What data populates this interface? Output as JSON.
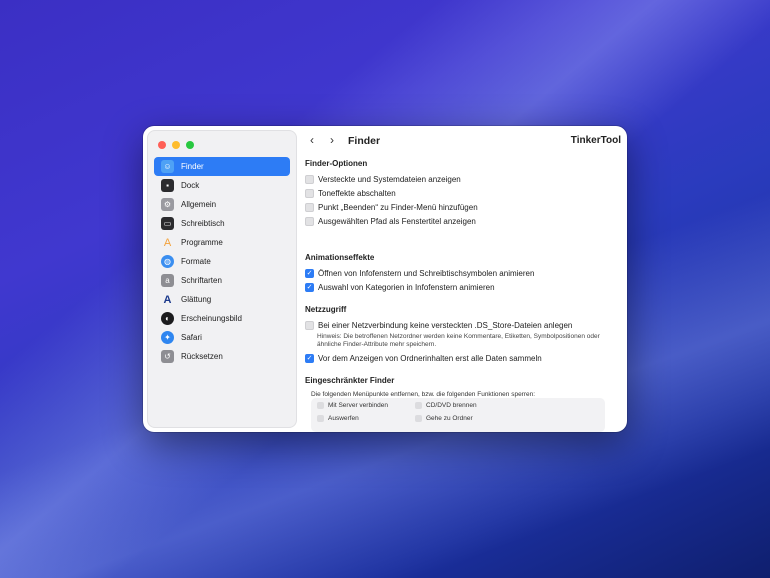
{
  "window": {
    "app_name": "TinkerTool",
    "page_title": "Finder"
  },
  "sidebar": {
    "items": [
      {
        "label": "Finder",
        "icon": "finder-icon",
        "color": "#4ea1f5",
        "active": true
      },
      {
        "label": "Dock",
        "icon": "dock-icon",
        "color": "#2b2b2e"
      },
      {
        "label": "Allgemein",
        "icon": "general-icon",
        "color": "#9a9aa0"
      },
      {
        "label": "Schreibtisch",
        "icon": "desktop-icon",
        "color": "#2b2b2e"
      },
      {
        "label": "Programme",
        "icon": "applications-icon",
        "color": "#f3a23b"
      },
      {
        "label": "Formate",
        "icon": "globe-icon",
        "color": "#3a8ef0"
      },
      {
        "label": "Schriftarten",
        "icon": "fonts-icon",
        "color": "#8e8e93"
      },
      {
        "label": "Glättung",
        "icon": "smoothing-icon",
        "color": "#1c3a8c"
      },
      {
        "label": "Erscheinungsbild",
        "icon": "appearance-icon",
        "color": "#1c1c1e"
      },
      {
        "label": "Safari",
        "icon": "safari-icon",
        "color": "#2f86f0"
      },
      {
        "label": "Rücksetzen",
        "icon": "reset-icon",
        "color": "#8e8e93"
      }
    ]
  },
  "sections": {
    "finder_options": {
      "title": "Finder-Optionen",
      "options": [
        {
          "label": "Versteckte und Systemdateien anzeigen",
          "checked": false
        },
        {
          "label": "Toneffekte abschalten",
          "checked": false
        },
        {
          "label": "Punkt „Beenden“ zu Finder-Menü hinzufügen",
          "checked": false
        },
        {
          "label": "Ausgewählten Pfad als Fenstertitel anzeigen",
          "checked": false
        }
      ]
    },
    "animation": {
      "title": "Animationseffekte",
      "options": [
        {
          "label": "Öffnen von Infofenstern und Schreibtischsymbolen animieren",
          "checked": true
        },
        {
          "label": "Auswahl von Kategorien in Infofenstern animieren",
          "checked": true
        }
      ]
    },
    "network": {
      "title": "Netzzugriff",
      "option1": "Bei einer Netzverbindung keine versteckten .DS_Store-Dateien anlegen",
      "option1_checked": false,
      "hint": "Hinweis: Die betroffenen Netzordner werden keine Kommentare, Etiketten, Symbolpositionen oder ähnliche Finder-Attribute mehr speichern.",
      "option2": "Vor dem Anzeigen von Ordnerinhalten erst alle Daten sammeln",
      "option2_checked": true
    },
    "restricted": {
      "title": "Eingeschränkter Finder",
      "note": "Die folgenden Menüpunkte entfernen, bzw. die folgenden Funktionen sperren:",
      "items": [
        "Mit Server verbinden",
        "CD/DVD brennen",
        "Auswerfen",
        "Gehe zu Ordner"
      ]
    }
  },
  "colors": {
    "accent": "#2d7cf5",
    "close": "#ff5f57",
    "minimize": "#febc2e",
    "zoom": "#28c840"
  }
}
